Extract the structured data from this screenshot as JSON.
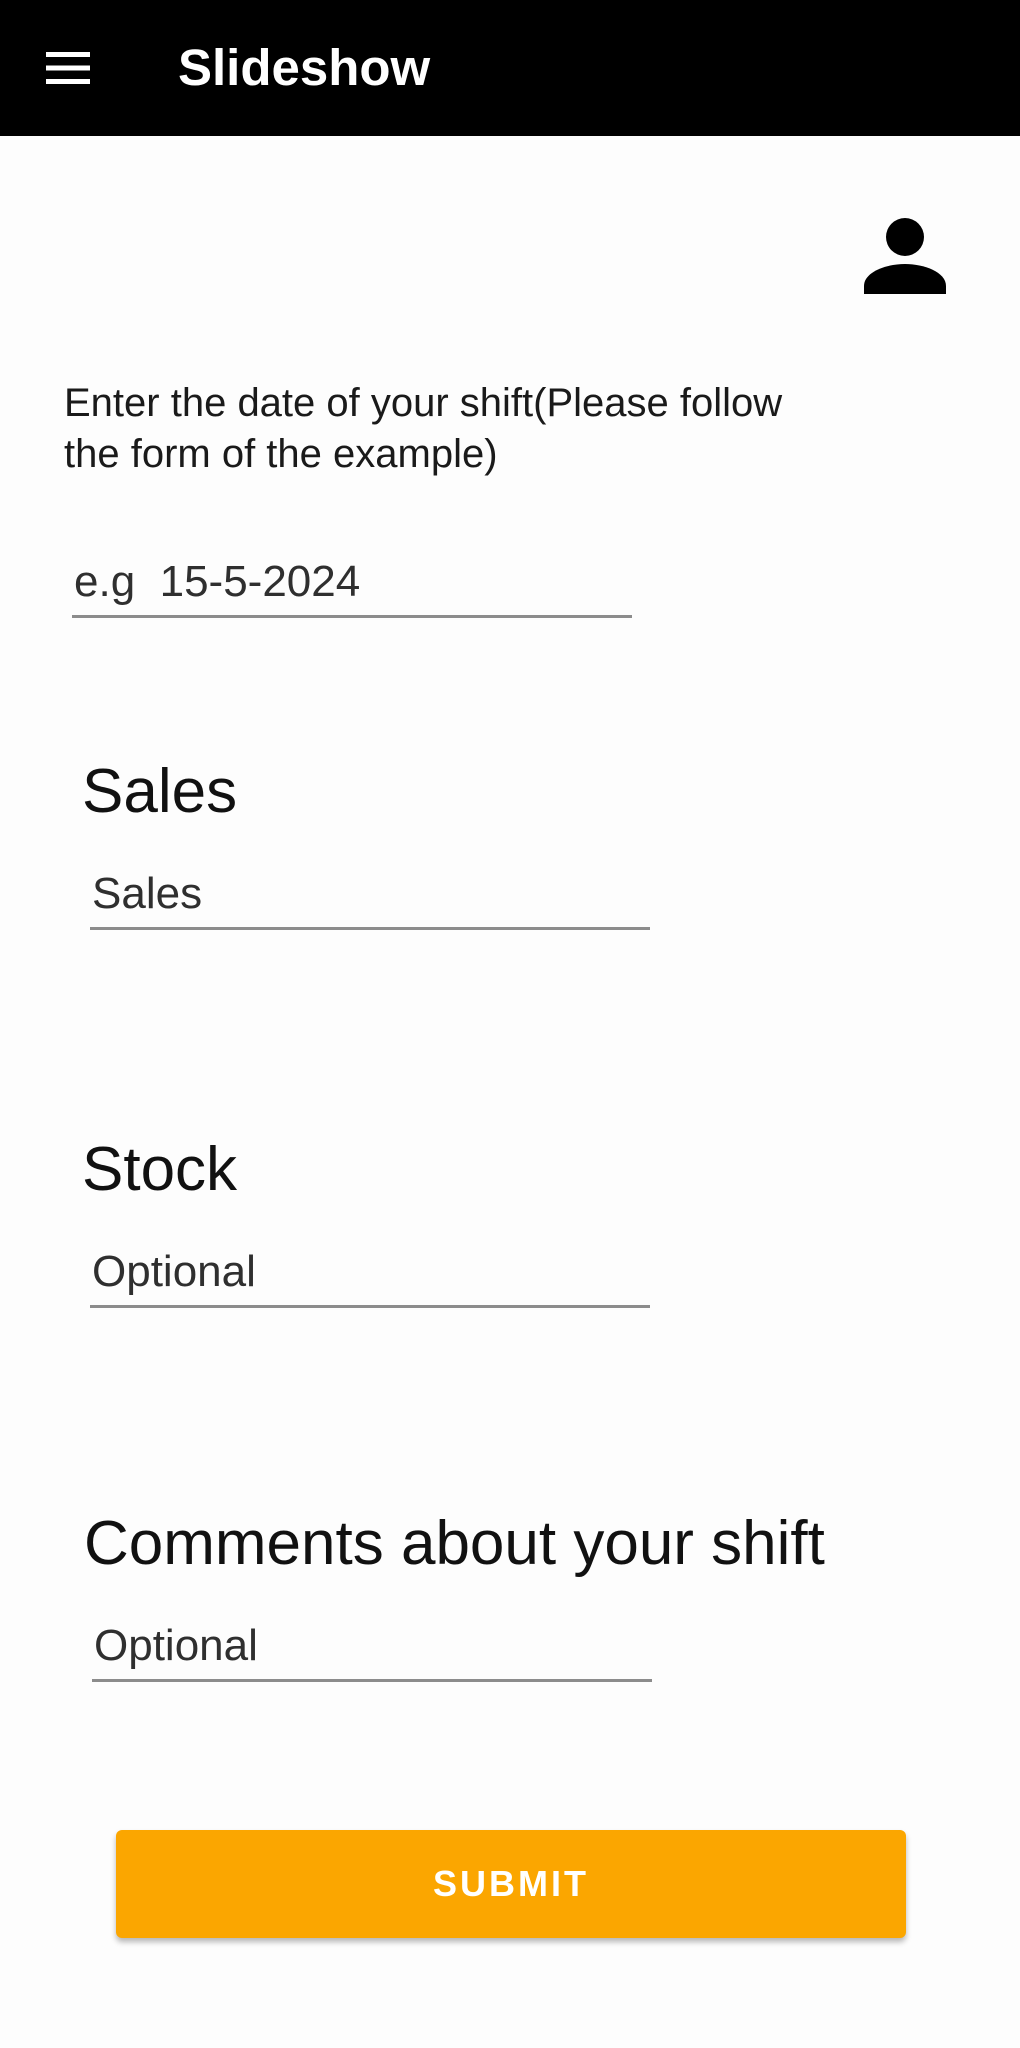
{
  "app_bar": {
    "title": "Slideshow",
    "menu_icon": "hamburger-menu-icon"
  },
  "profile": {
    "icon": "person-icon"
  },
  "form": {
    "instruction": "Enter the date of your shift(Please follow the form of the example)",
    "date": {
      "placeholder": "e.g  15-5-2024",
      "value": ""
    },
    "sales": {
      "label": "Sales",
      "placeholder": "Sales",
      "value": ""
    },
    "stock": {
      "label": "Stock",
      "placeholder": "Optional",
      "value": ""
    },
    "comments": {
      "label": "Comments about your shift",
      "placeholder": "Optional",
      "value": ""
    },
    "submit_label": "SUBMIT"
  },
  "colors": {
    "app_bar": "#000000",
    "accent": "#fba600",
    "background": "#fdfdfd"
  }
}
